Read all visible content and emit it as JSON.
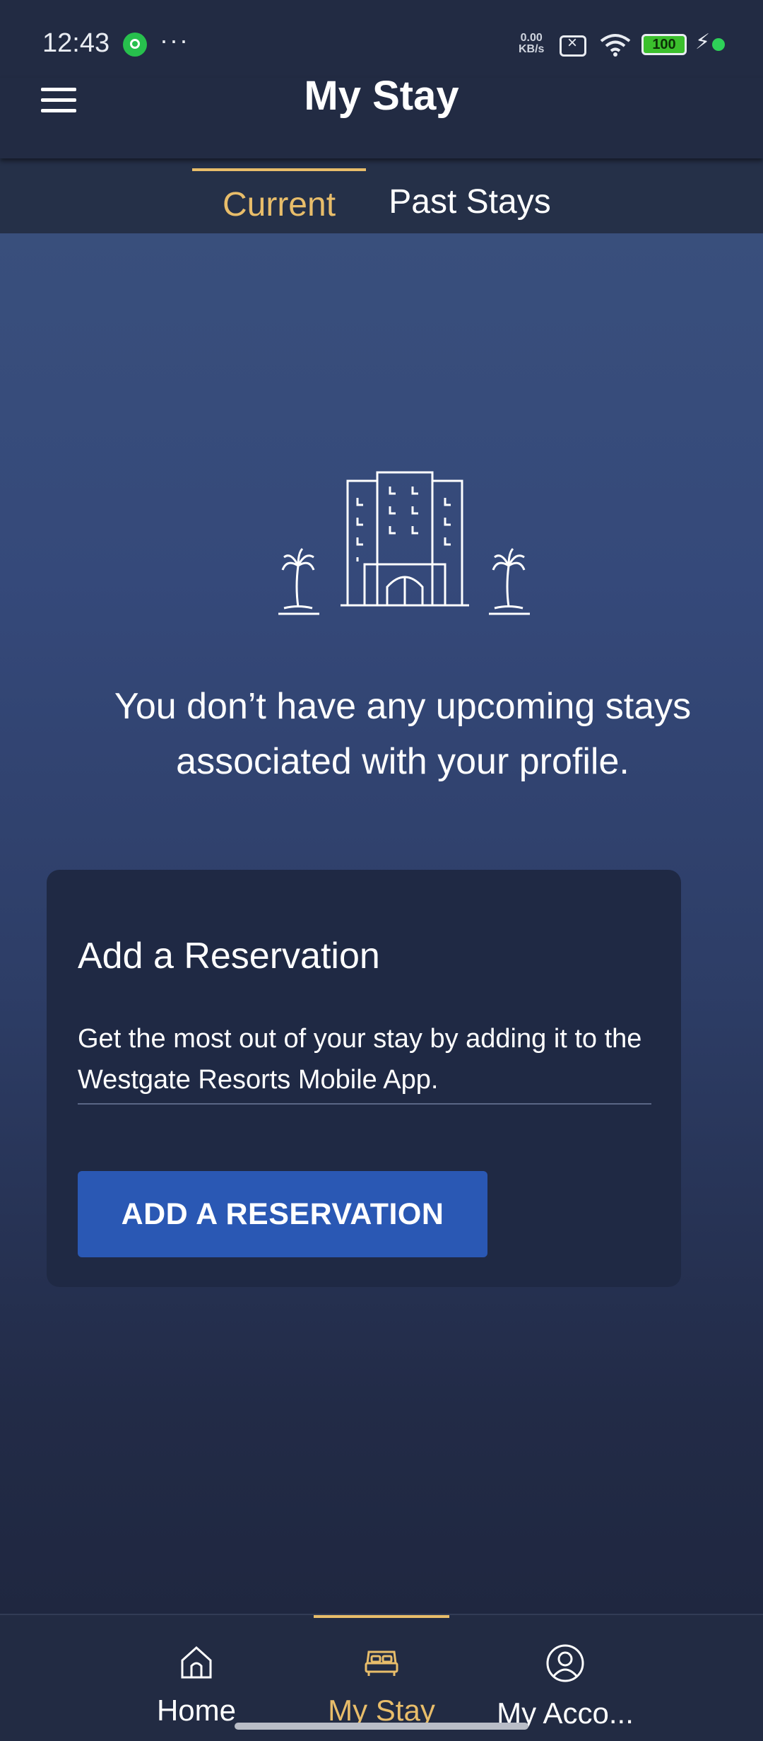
{
  "status_bar": {
    "time": "12:43",
    "more": "···",
    "net_speed_value": "0.00",
    "net_speed_unit": "KB/s",
    "battery": "100"
  },
  "header": {
    "title": "My Stay"
  },
  "tabs": [
    {
      "label": "Current",
      "active": true
    },
    {
      "label": "Past Stays",
      "active": false
    }
  ],
  "empty_state": {
    "icon": "hotel-with-palm-trees-icon",
    "message": "You don’t have any upcoming stays associated with your profile."
  },
  "reservation_card": {
    "title": "Add a Reservation",
    "description": "Get the most out of your stay by adding it to the Westgate Resorts Mobile App.",
    "button_label": "ADD A RESERVATION"
  },
  "bottom_nav": [
    {
      "label": "Home",
      "icon": "home-icon",
      "active": false
    },
    {
      "label": "My Stay",
      "icon": "bed-icon",
      "active": true
    },
    {
      "label": "My Acco...",
      "icon": "account-icon",
      "active": false
    }
  ],
  "colors": {
    "accent": "#e8bd6a",
    "button": "#2a58b4",
    "header_bg": "#222b43",
    "card_bg": "#1f2944"
  }
}
